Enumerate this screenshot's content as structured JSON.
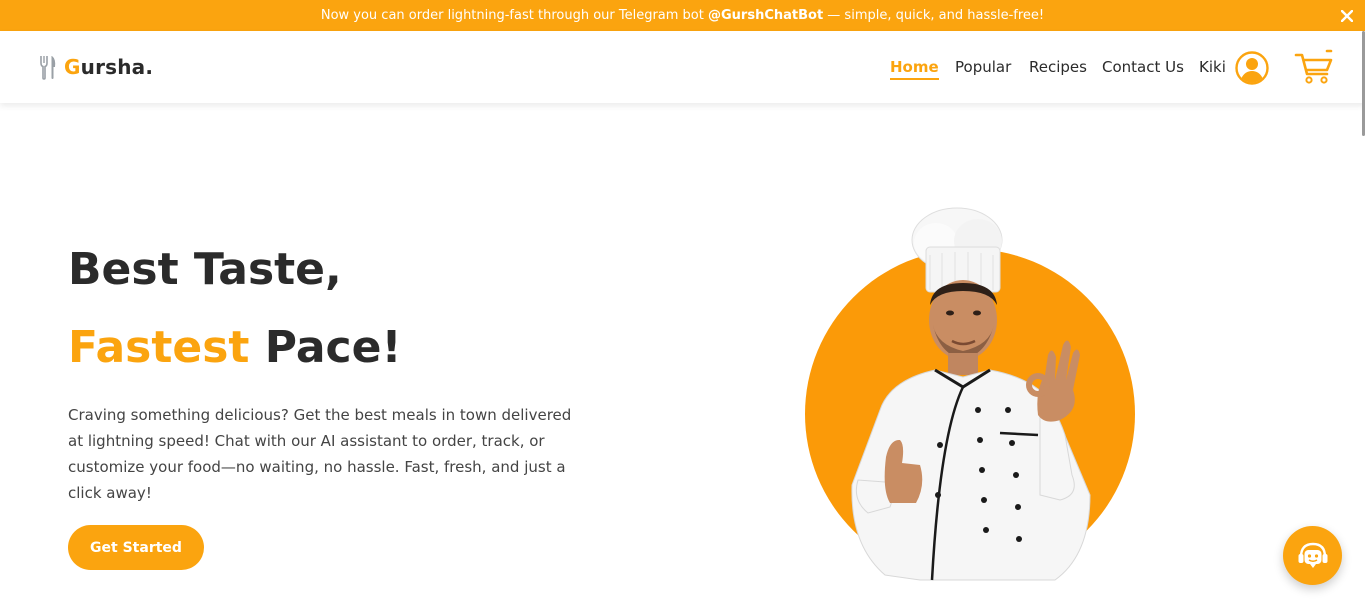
{
  "announcement": {
    "text_before": "Now you can order lightning-fast through our Telegram bot ",
    "bot_handle": "@GurshChatBot",
    "text_after": " — simple, quick, and hassle-free!",
    "close_icon": "close-icon"
  },
  "brand": {
    "first_letter": "G",
    "rest": "ursha.",
    "icon": "fork-knife-icon"
  },
  "nav": {
    "items": [
      {
        "label": "Home",
        "active": true
      },
      {
        "label": "Popular",
        "active": false
      },
      {
        "label": "Recipes",
        "active": false
      },
      {
        "label": "Contact Us",
        "active": false
      }
    ],
    "user_name": "Kiki",
    "user_icon": "user-circle-icon",
    "cart_icon": "cart-icon"
  },
  "hero": {
    "title_line1": "Best Taste,",
    "title_line2_accent": "Fastest",
    "title_line2_rest": " Pace!",
    "description": "Craving something delicious? Get the best meals in town delivered at lightning speed! Chat with our AI assistant to order, track, or customize your food—no waiting, no hassle. Fast, fresh, and just a click away!",
    "cta_label": "Get Started",
    "image": "chef-photo"
  },
  "chat_widget": {
    "icon": "chat-support-icon"
  },
  "colors": {
    "accent": "#fba40f",
    "text": "#2b2b2b",
    "background": "#ffffff"
  }
}
